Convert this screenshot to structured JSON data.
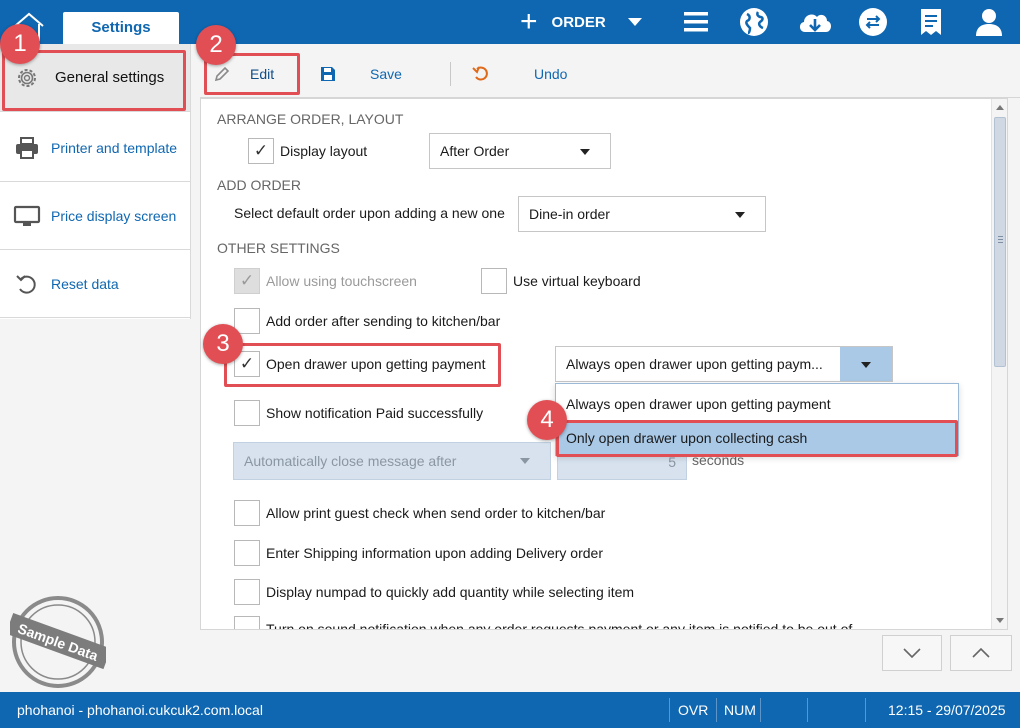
{
  "colors": {
    "brand": "#0f67b1",
    "annotation": "#e14f54",
    "highlight": "#a9c9e7"
  },
  "header": {
    "tab_label": "Settings",
    "order_label": "ORDER",
    "icons": [
      "home-icon",
      "plus-icon",
      "menu-icon",
      "globe-icon",
      "cloud-download-icon",
      "sync-icon",
      "receipt-icon",
      "user-icon"
    ]
  },
  "sidebar": {
    "items": [
      {
        "label": "General settings",
        "icon": "gear-icon"
      },
      {
        "label": "Printer and template",
        "icon": "printer-icon"
      },
      {
        "label": "Price display screen",
        "icon": "monitor-icon"
      },
      {
        "label": "Reset data",
        "icon": "reset-icon"
      }
    ]
  },
  "toolbar": {
    "edit_label": "Edit",
    "save_label": "Save",
    "undo_label": "Undo"
  },
  "sections": {
    "arrange": "ARRANGE ORDER, LAYOUT",
    "add_order": "ADD ORDER",
    "other": "OTHER SETTINGS"
  },
  "settings": {
    "display_layout": {
      "label": "Display layout",
      "checked": true,
      "select": "After Order"
    },
    "default_order": {
      "label": "Select default order upon adding a new one",
      "select": "Dine-in order"
    },
    "touchscreen": {
      "label": "Allow using touchscreen",
      "checked": true,
      "disabled": true
    },
    "virtual_keyboard": {
      "label": "Use virtual keyboard",
      "checked": false
    },
    "add_after_kitchen": {
      "label": "Add order after sending to kitchen/bar",
      "checked": false
    },
    "open_drawer": {
      "label": "Open drawer upon getting payment",
      "checked": true,
      "select": "Always open drawer upon getting paym..."
    },
    "notification_paid": {
      "label": "Show notification Paid successfully",
      "checked": false
    },
    "auto_close": {
      "select": "Automatically close message after",
      "seconds_value": "5",
      "seconds_label": "seconds"
    },
    "print_guest_check": {
      "label": "Allow print guest check when send order to kitchen/bar",
      "checked": false
    },
    "shipping_info": {
      "label": "Enter Shipping information upon adding Delivery order",
      "checked": false
    },
    "numpad": {
      "label": "Display numpad to quickly add quantity while selecting item",
      "checked": false
    },
    "sound_notification": {
      "label": "Turn on sound notification when any order requests payment or any item is notified to be out of",
      "checked": false
    }
  },
  "dropdown": {
    "options": [
      "Always open drawer upon getting payment",
      "Only open drawer upon collecting cash"
    ],
    "highlighted_index": 1
  },
  "annotations": {
    "badges": [
      "1",
      "2",
      "3",
      "4"
    ]
  },
  "watermark": "Sample Data",
  "statusbar": {
    "host": "phohanoi - phohanoi.cukcuk2.com.local",
    "ovr": "OVR",
    "num": "NUM",
    "datetime": "12:15 - 29/07/2025"
  }
}
